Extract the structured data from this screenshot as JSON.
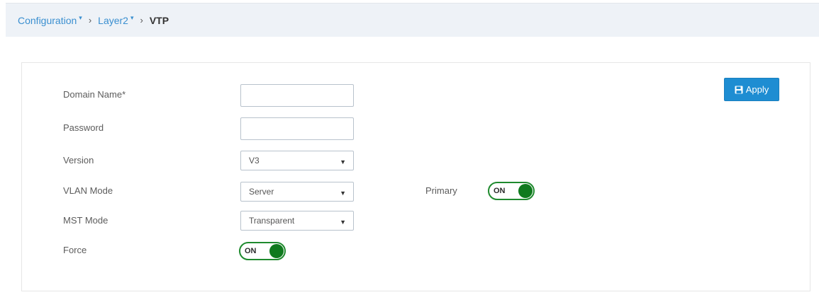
{
  "breadcrumb": {
    "items": [
      {
        "label": "Configuration",
        "caret": "▾"
      },
      {
        "label": "Layer2",
        "caret": "▾"
      }
    ],
    "separator": "›",
    "current": "VTP"
  },
  "form": {
    "domain_name": {
      "label": "Domain Name*",
      "value": ""
    },
    "password": {
      "label": "Password",
      "value": ""
    },
    "version": {
      "label": "Version",
      "value": "V3"
    },
    "vlan_mode": {
      "label": "VLAN Mode",
      "value": "Server"
    },
    "mst_mode": {
      "label": "MST Mode",
      "value": "Transparent"
    },
    "force": {
      "label": "Force",
      "state": "ON"
    },
    "primary": {
      "label": "Primary",
      "state": "ON"
    }
  },
  "actions": {
    "apply_label": "Apply",
    "apply_icon": "save-icon"
  },
  "colors": {
    "accent": "#1e8dd2",
    "toggle_on": "#0f7a1e",
    "breadcrumb_link": "#3a8fd0"
  },
  "icons": {
    "select_arrow": "▼"
  }
}
